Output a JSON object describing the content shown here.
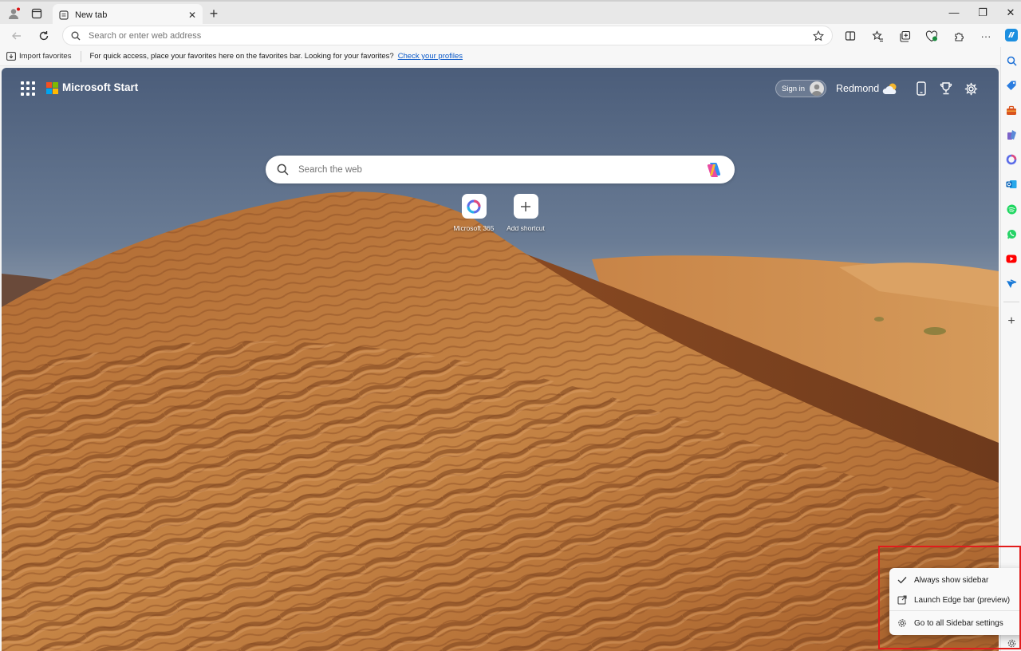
{
  "browser": {
    "tab": {
      "title": "New tab"
    },
    "address_bar": {
      "placeholder": "Search or enter web address"
    },
    "favorites_bar": {
      "import_label": "Import favorites",
      "message": "For quick access, place your favorites here on the favorites bar. Looking for your favorites?",
      "link_label": "Check your profiles"
    }
  },
  "page": {
    "brand": "Microsoft Start",
    "sign_in_label": "Sign in",
    "location": "Redmond",
    "search": {
      "placeholder": "Search the web"
    },
    "shortcuts": [
      {
        "label": "Microsoft 365",
        "icon": "microsoft-365-icon"
      },
      {
        "label": "Add shortcut",
        "icon": "plus-icon"
      }
    ]
  },
  "sidebar": {
    "items": [
      "search",
      "shopping",
      "tools",
      "games",
      "microsoft-365",
      "outlook",
      "spotify",
      "whatsapp",
      "youtube",
      "designer"
    ],
    "add_label": "+",
    "settings_icon": "gear-icon"
  },
  "context_menu": {
    "items": [
      {
        "label": "Always show sidebar",
        "icon": "checkmark-icon",
        "checked": true
      },
      {
        "label": "Launch Edge bar (preview)",
        "icon": "external-link-icon"
      },
      {
        "label": "Go to all Sidebar settings",
        "icon": "gear-icon"
      }
    ]
  },
  "colors": {
    "accent": "#0a58c8",
    "highlight_box": "#e21c1c",
    "sand": "#c17b3f"
  }
}
